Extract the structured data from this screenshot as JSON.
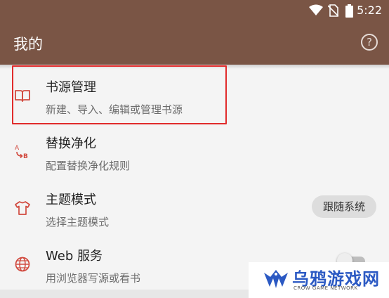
{
  "status_bar": {
    "time": "5:22",
    "icons": [
      "wifi-icon",
      "no-sim-icon",
      "battery-icon"
    ]
  },
  "app_bar": {
    "title": "我的",
    "help_icon": "help-circle-icon",
    "help_glyph": "?"
  },
  "settings": [
    {
      "id": "book-source",
      "icon": "book-open-icon",
      "title": "书源管理",
      "subtitle": "新建、导入、编辑或管理书源"
    },
    {
      "id": "replace-purify",
      "icon": "text-replace-icon",
      "title": "替换净化",
      "subtitle": "配置替换净化规则"
    },
    {
      "id": "theme-mode",
      "icon": "tshirt-icon",
      "title": "主题模式",
      "subtitle": "选择主题模式",
      "value": "跟随系统"
    },
    {
      "id": "web-service",
      "icon": "globe-icon",
      "title": "Web 服务",
      "subtitle": "用浏览器写源或看书",
      "toggle": "off"
    }
  ],
  "colors": {
    "app_bar": "#7a5545",
    "icon_accent": "#d14a3f",
    "highlight_border": "#e12b2b"
  },
  "watermark": {
    "name": "乌鸦游戏网",
    "tagline": "CROW GAME NETWORK"
  }
}
